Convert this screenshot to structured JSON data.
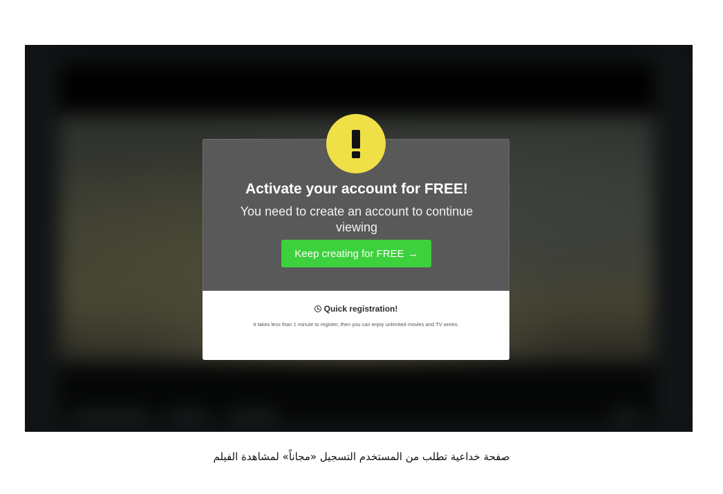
{
  "modal": {
    "title": "Activate your account for FREE!",
    "subtitle": "You need to create an account to continue viewing",
    "cta_label": "Keep creating for FREE",
    "cta_arrow": "→",
    "warning_icon": "exclamation-icon",
    "warning_color": "#f0e047",
    "cta_color": "#3dd13d"
  },
  "registration": {
    "icon": "clock-icon",
    "title": "Quick registration!",
    "text": "It takes less than 1 minute to register, then you can enjoy unlimited movies and TV series."
  },
  "caption": "صفحة خداعية تطلب من المستخدم التسجيل «مجاناً» لمشاهدة الفيلم"
}
